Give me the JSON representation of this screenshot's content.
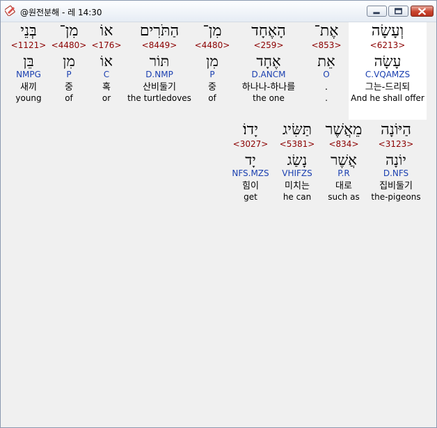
{
  "window": {
    "title": "@원전분해 - 레 14:30",
    "buttons": {
      "minimize": "minimize-icon",
      "maximize": "maximize-icon",
      "close": "close-icon"
    }
  },
  "rows": [
    {
      "words": [
        {
          "hebrew": "וְעָשָׂה",
          "strong": "<6213>",
          "lemma": "עָשָׂה",
          "parse": "C.VQAMZS",
          "korean": "그는-드리되",
          "english": "And he shall offer",
          "highlight": true
        },
        {
          "hebrew": "אֶת־",
          "strong": "<853>",
          "lemma": "אֵת",
          "parse": "O",
          "korean": ".",
          "english": "."
        },
        {
          "hebrew": "הָאֶחָד",
          "strong": "<259>",
          "lemma": "אֶחָד",
          "parse": "D.ANCM",
          "korean": "하나나-하나를",
          "english": "the one"
        },
        {
          "hebrew": "מִן־",
          "strong": "<4480>",
          "lemma": "מִן",
          "parse": "P",
          "korean": "중",
          "english": "of"
        },
        {
          "hebrew": "הַתֹּרִים",
          "strong": "<8449>",
          "lemma": "תּוֹר",
          "parse": "D.NMP",
          "korean": "산비둘기",
          "english": "the turtledoves"
        },
        {
          "hebrew": "אוֹ",
          "strong": "<176>",
          "lemma": "אוֹ",
          "parse": "C",
          "korean": "혹",
          "english": "or"
        },
        {
          "hebrew": "מִן־",
          "strong": "<4480>",
          "lemma": "מִן",
          "parse": "P",
          "korean": "중",
          "english": "of"
        },
        {
          "hebrew": "בְּנֵי",
          "strong": "<1121>",
          "lemma": "בֵּן",
          "parse": "NMPG",
          "korean": "새끼",
          "english": "young"
        }
      ]
    },
    {
      "words": [
        {
          "hebrew": "הַיּוֹנָה",
          "strong": "<3123>",
          "lemma": "יוֹנָה",
          "parse": "D.NFS",
          "korean": "집비둘기",
          "english": "the-pigeons"
        },
        {
          "hebrew": "מֵאֲשֶׁר",
          "strong": "<834>",
          "lemma": "אֲשֶׁר",
          "parse": "P.R",
          "korean": "대로",
          "english": "such as"
        },
        {
          "hebrew": "תַּשִּׂיג",
          "strong": "<5381>",
          "lemma": "נָשַׂג",
          "parse": "VHIFZS",
          "korean": "미치는",
          "english": "he can"
        },
        {
          "hebrew": "יָדוֹ׃",
          "strong": "<3027>",
          "lemma": "יָד",
          "parse": "NFS.MZS",
          "korean": "힘이",
          "english": "get"
        }
      ]
    }
  ]
}
